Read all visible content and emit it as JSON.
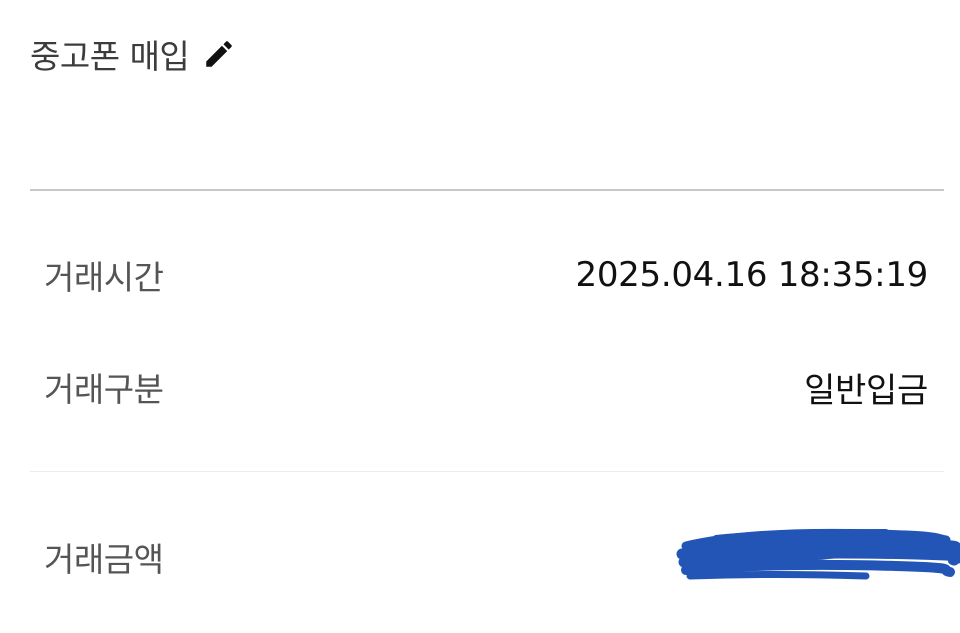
{
  "memo": {
    "title": "중고폰 매입",
    "edit_icon": "pencil-icon"
  },
  "details": {
    "time_label": "거래시간",
    "time_value": "2025.04.16 18:35:19",
    "type_label": "거래구분",
    "type_value": "일반입금",
    "amount_label": "거래금액"
  },
  "colors": {
    "redaction_scribble": "#1a4fb3",
    "divider": "#c8c8c8"
  }
}
